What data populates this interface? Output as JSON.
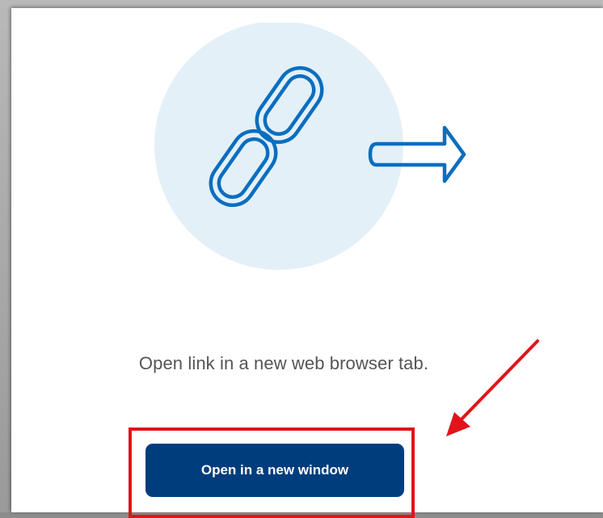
{
  "dialog": {
    "message": "Open link in a new web browser tab.",
    "button_label": "Open in a new window"
  },
  "icons": {
    "illustration": "link-chain-icon",
    "exit_arrow": "arrow-right-icon",
    "annotation": "red-annotation-arrow"
  },
  "colors": {
    "button": "#003d7d",
    "illustration_circle": "#e4f0f8",
    "illustration_stroke": "#0a6ec0",
    "annotation": "#e0141b"
  }
}
